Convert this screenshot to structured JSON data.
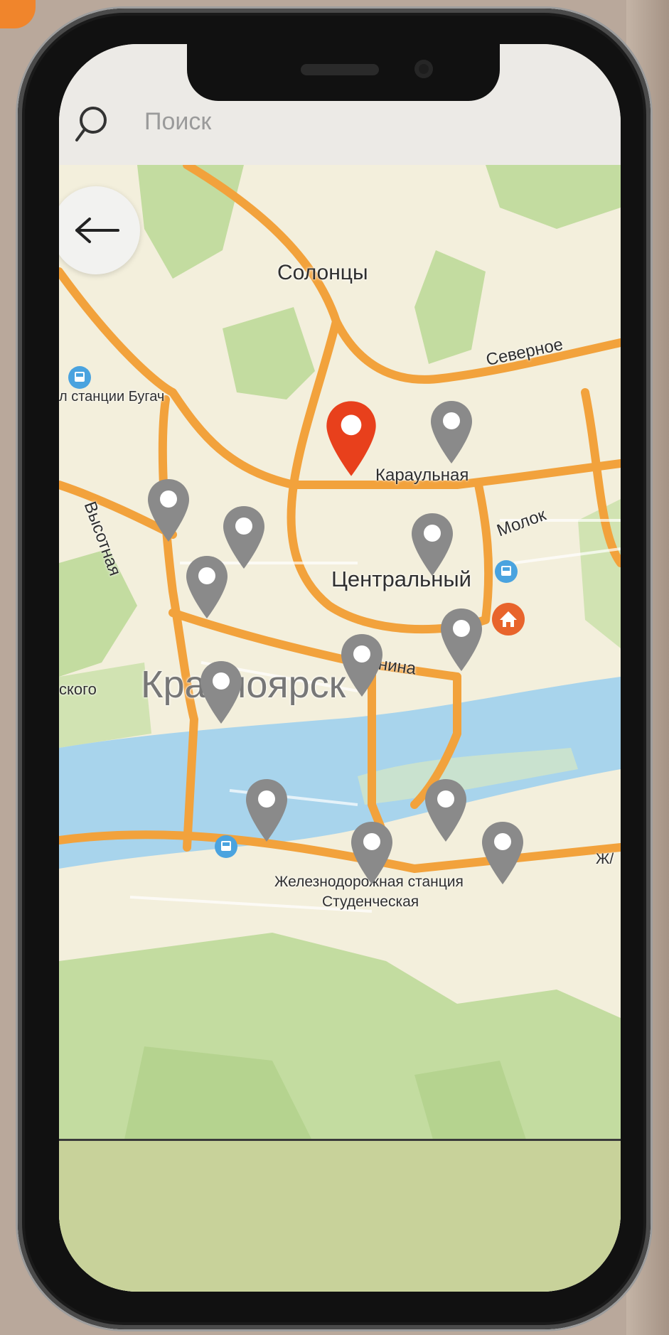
{
  "search": {
    "placeholder": "Поиск"
  },
  "map": {
    "labels": {
      "district_north": "Солонцы",
      "district_center": "Центральный",
      "city": "Красноярск",
      "street_karaulnaya": "Караульная",
      "street_vysotnaya": "Высотная",
      "street_lenina": "Ленина",
      "street_severnoe": "Северное",
      "street_molok": "Молок",
      "stop_bugach": "л станции Бугач",
      "edge_skogo": "ского",
      "station_line1": "Железнодорожная станция",
      "station_line2": "Студенческая",
      "edge_zh": "Ж/"
    },
    "selected_pin_color": "#e8401c",
    "pin_color": "#8a8a8a",
    "water_color": "#a8d4ec",
    "road_color": "#f2a23c"
  },
  "icons": {
    "search": "search-icon",
    "back": "arrow-left-icon",
    "pin": "location-pin-icon",
    "bus": "bus-stop-icon",
    "home": "home-icon"
  }
}
